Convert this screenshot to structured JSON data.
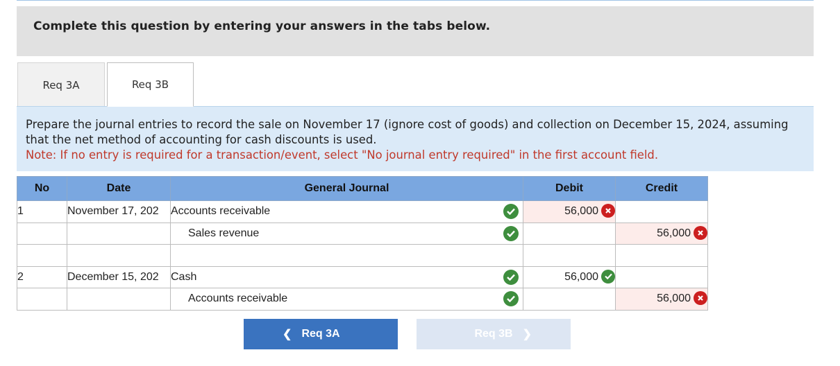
{
  "header": {
    "title": "Complete this question by entering your answers in the tabs below."
  },
  "tabs": [
    {
      "label": "Req 3A",
      "active": false
    },
    {
      "label": "Req 3B",
      "active": true
    }
  ],
  "instructions": {
    "text": "Prepare the journal entries to record the sale on November 17 (ignore cost of goods) and collection on December 15, 2024, assuming that the net method of accounting for cash discounts is used.",
    "note": "Note: If no entry is required for a transaction/event, select \"No journal entry required\" in the first account field."
  },
  "table": {
    "headers": {
      "no": "No",
      "date": "Date",
      "journal": "General Journal",
      "debit": "Debit",
      "credit": "Credit"
    },
    "rows": [
      {
        "no": "1",
        "date": "November 17, 202",
        "account": "Accounts receivable",
        "debit": "56,000",
        "credit": ""
      },
      {
        "no": "",
        "date": "",
        "account": "Sales revenue",
        "debit": "",
        "credit": "56,000"
      },
      {
        "no": "",
        "date": "",
        "account": "",
        "debit": "",
        "credit": ""
      },
      {
        "no": "2",
        "date": "December 15, 202",
        "account": "Cash",
        "debit": "56,000",
        "credit": ""
      },
      {
        "no": "",
        "date": "",
        "account": "Accounts receivable",
        "debit": "",
        "credit": "56,000"
      }
    ],
    "marks": {
      "account_check_color": "#3e8e3e",
      "wrong_color": "#cc1f1f",
      "wrong_bg": "#fdecea"
    }
  },
  "nav": {
    "prev_label": "Req 3A",
    "prev_icon": "chevron-left-icon",
    "next_label": "Req 3B",
    "next_icon": "chevron-right-icon",
    "prev_color": "#3a73bf",
    "next_color": "#dde6f3"
  }
}
